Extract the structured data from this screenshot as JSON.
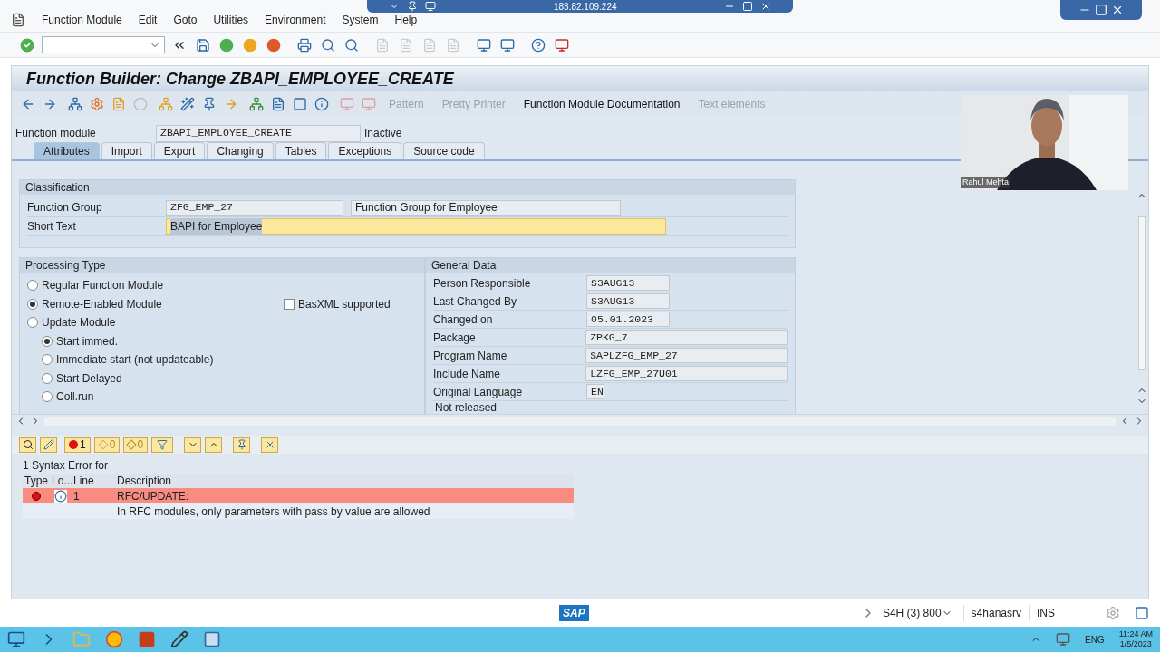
{
  "remote_bar": {
    "address": "183.82.109.224"
  },
  "menu": [
    "Function Module",
    "Edit",
    "Goto",
    "Utilities",
    "Environment",
    "System",
    "Help"
  ],
  "title": "Function Builder: Change ZBAPI_EMPLOYEE_CREATE",
  "app_toolbar": [
    {
      "label": "Pattern",
      "disabled": true
    },
    {
      "label": "Pretty Printer",
      "disabled": true
    },
    {
      "label": "Function Module Documentation",
      "disabled": false
    },
    {
      "label": "Text elements",
      "disabled": true
    }
  ],
  "function_module": {
    "label": "Function module",
    "value": "ZBAPI_EMPLOYEE_CREATE",
    "status": "Inactive"
  },
  "tabs": [
    {
      "label": "Attributes",
      "selected": true
    },
    {
      "label": "Import",
      "selected": false
    },
    {
      "label": "Export",
      "selected": false
    },
    {
      "label": "Changing",
      "selected": false
    },
    {
      "label": "Tables",
      "selected": false
    },
    {
      "label": "Exceptions",
      "selected": false
    },
    {
      "label": "Source code",
      "selected": false
    }
  ],
  "classification": {
    "title": "Classification",
    "group_label": "Function Group",
    "group_value": "ZFG_EMP_27",
    "group_text": "Function Group for Employee",
    "short_label": "Short Text",
    "short_value": "BAPI for Employee"
  },
  "processing_type": {
    "title": "Processing Type",
    "options": [
      {
        "label": "Regular Function Module",
        "selected": false
      },
      {
        "label": "Remote-Enabled Module",
        "selected": true
      },
      {
        "label": "Update Module",
        "selected": false,
        "children": [
          {
            "label": "Start immed.",
            "selected": true
          },
          {
            "label": "Immediate start (not updateable)",
            "selected": false
          },
          {
            "label": "Start Delayed",
            "selected": false
          },
          {
            "label": "Coll.run",
            "selected": false
          }
        ]
      }
    ],
    "basxml": {
      "label": "BasXML supported",
      "checked": false
    }
  },
  "general_data": {
    "title": "General Data",
    "fields": [
      {
        "label": "Person Responsible",
        "value": "S3AUG13"
      },
      {
        "label": "Last Changed By",
        "value": "S3AUG13"
      },
      {
        "label": "Changed on",
        "value": "05.01.2023"
      },
      {
        "label": "Package",
        "value": "ZPKG_7"
      },
      {
        "label": "Program Name",
        "value": "SAPLZFG_EMP_27"
      },
      {
        "label": "Include Name",
        "value": "LZFG_EMP_27U01"
      },
      {
        "label": "Original Language",
        "value": "EN"
      }
    ],
    "footer": "Not released"
  },
  "video": {
    "kind": "picture",
    "name": "Rahul Mehta"
  },
  "error_toolbar": {
    "errors": "1",
    "warnings": "0",
    "infos": "0"
  },
  "message": "1 Syntax Error for",
  "error_table": {
    "columns": [
      "Type",
      "Lo...",
      "Line",
      "Description"
    ],
    "rows": [
      {
        "line": "1",
        "description": "RFC/UPDATE:",
        "selected": true
      },
      {
        "line": "",
        "description": "In RFC modules, only parameters with pass by value are allowed",
        "selected": false
      }
    ]
  },
  "status_bar": {
    "logo": "SAP",
    "system": "S4H (3) 800",
    "server": "s4hanasrv",
    "mode": "INS"
  },
  "taskbar": {
    "language": "ENG",
    "time": "11:24 AM",
    "date": "1/5/2023"
  }
}
